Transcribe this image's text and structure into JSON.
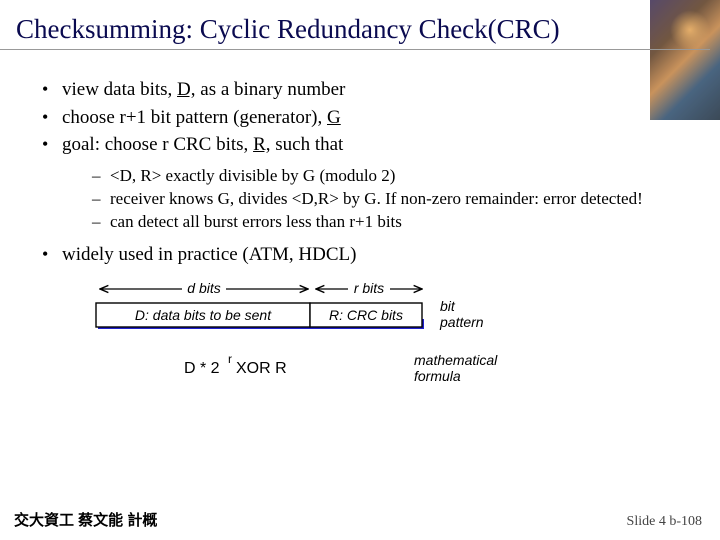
{
  "title": "Checksumming: Cyclic Redundancy Check(CRC)",
  "bullets": {
    "b1a": "view data bits, ",
    "b1u": "D,",
    "b1b": " as a binary number",
    "b2a": "choose r+1 bit pattern (generator), ",
    "b2u": "G",
    "b3a": "goal: choose r CRC bits, ",
    "b3u": "R,",
    "b3b": " such that",
    "b4": "widely used in practice (ATM, HDCL)"
  },
  "sub": {
    "s1": " <D, R> exactly divisible by G (modulo 2)",
    "s2": "receiver knows G, divides <D,R> by G.  If non-zero remainder: error detected!",
    "s3": "can detect all burst errors less than r+1 bits"
  },
  "diagram": {
    "dbits": "d bits",
    "rbits": "r bits",
    "data_box": "D: data bits to be sent",
    "crc_box": "R: CRC bits",
    "bitpattern": "bit pattern",
    "formula_d": "D * 2",
    "formula_exp": "r",
    "formula_rest": "   XOR   R",
    "math_label": "mathematical formula"
  },
  "footer": {
    "left": "交大資工 蔡文能 計概",
    "right": "Slide 4 b-108"
  }
}
